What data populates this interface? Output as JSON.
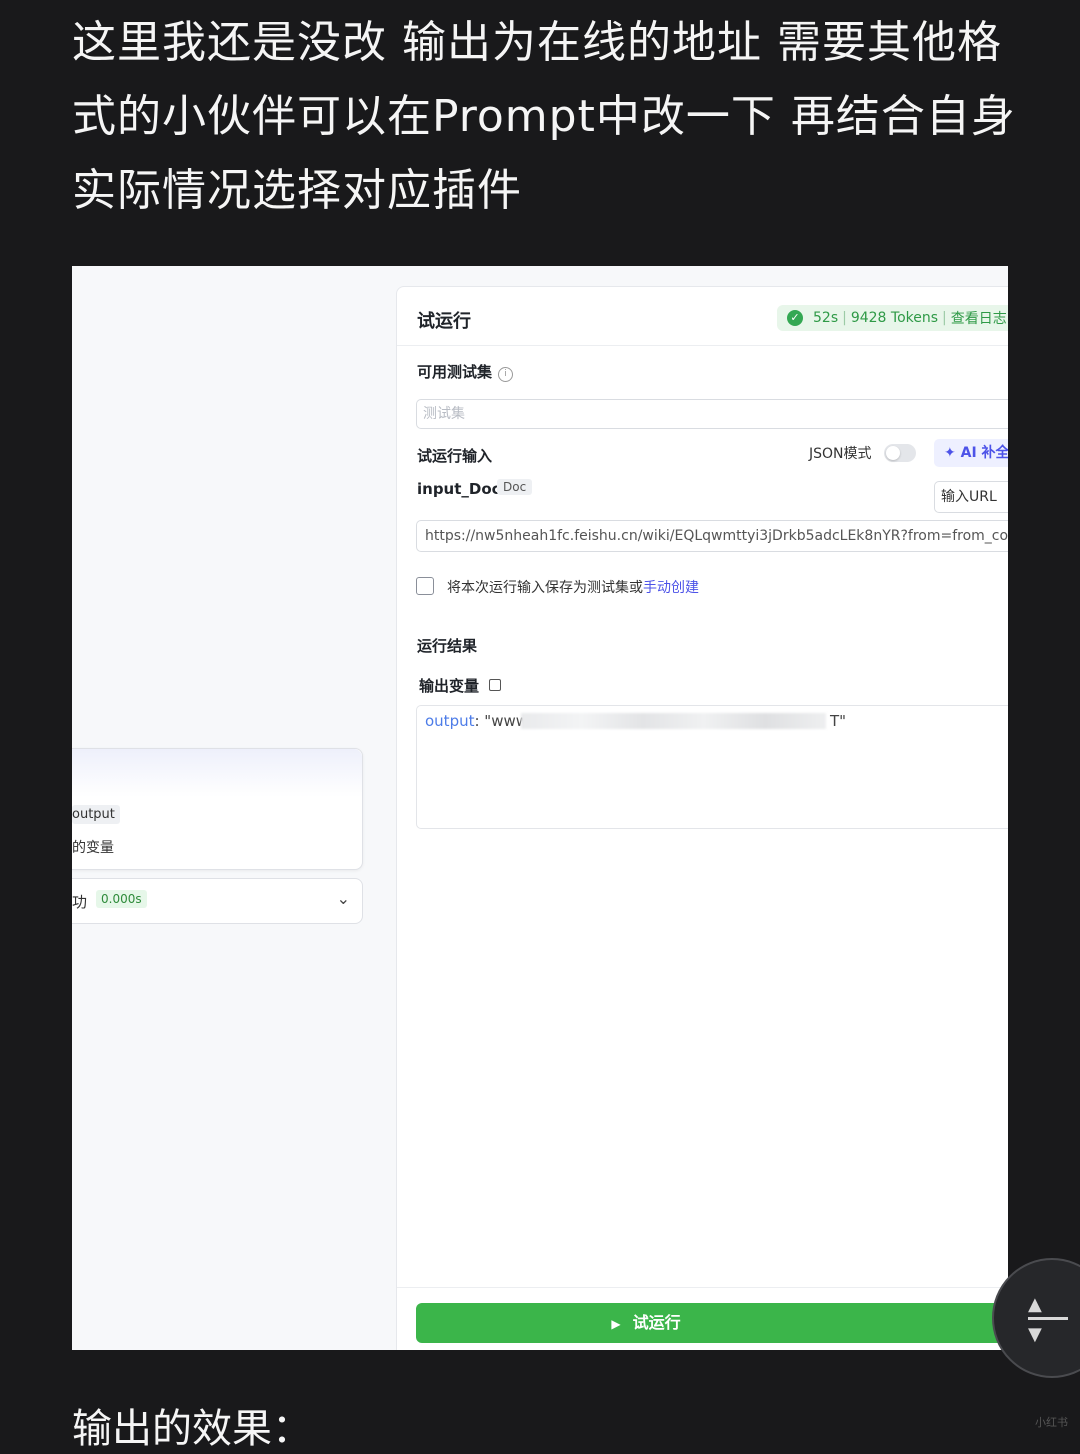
{
  "intro_lines": [
    "这里我还是没改 输出为在线的地址 需要其他格",
    "式的小伙伴可以在Prompt中改一下 再结合自身",
    "实际情况选择对应插件"
  ],
  "canvas": {
    "node_tag": "output",
    "node_var": "的变量",
    "status_text": "功",
    "status_time": "0.000s"
  },
  "panel": {
    "title": "试运行",
    "stats": {
      "duration": "52s",
      "tokens": "9428 Tokens",
      "log_link": "查看日志"
    },
    "test_set_label": "可用测试集",
    "test_set_placeholder": "测试集",
    "run_input_label": "试运行输入",
    "json_mode_label": "JSON模式",
    "ai_fill_label": "AI 补全",
    "param_name": "input_Doc",
    "param_type": "Doc",
    "url_button": "输入URL",
    "url_value": "https://nw5nheah1fc.feishu.cn/wiki/EQLqwmttyi3jDrkb5adcLEk8nYR?from=from_co",
    "save_text": "将本次运行输入保存为测试集或",
    "save_link": "手动创建",
    "result_label": "运行结果",
    "output_var_label": "输出变量",
    "output_key": "output",
    "output_prefix": ": \"www",
    "output_suffix": "T\"",
    "run_button": "试运行"
  },
  "outro": "输出的效果：",
  "watermark": "小红书",
  "colors": {
    "run_green": "#3bb54a",
    "accent_blue": "#4d53e8",
    "badge_green": "#2f9a47"
  }
}
